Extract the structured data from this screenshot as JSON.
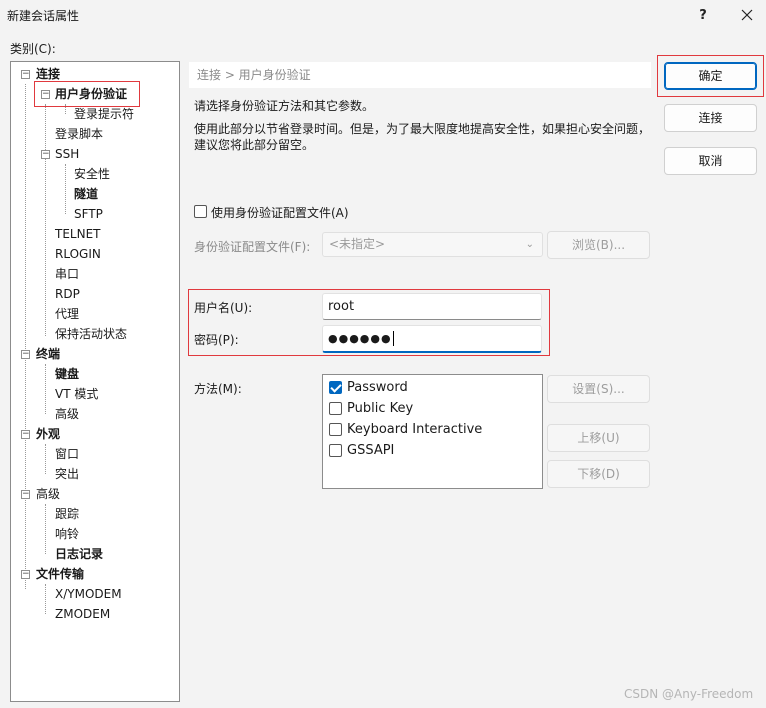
{
  "window": {
    "title": "新建会话属性",
    "help": "?",
    "close": "✕"
  },
  "category_label": "类别(C):",
  "tree": {
    "items": [
      {
        "label": "连接",
        "bold": true
      },
      {
        "label": "用户身份验证",
        "bold": true
      },
      {
        "label": "登录提示符",
        "bold": false
      },
      {
        "label": "登录脚本",
        "bold": false
      },
      {
        "label": "SSH",
        "bold": false
      },
      {
        "label": "安全性",
        "bold": false
      },
      {
        "label": "隧道",
        "bold": true
      },
      {
        "label": "SFTP",
        "bold": false
      },
      {
        "label": "TELNET",
        "bold": false
      },
      {
        "label": "RLOGIN",
        "bold": false
      },
      {
        "label": "串口",
        "bold": false
      },
      {
        "label": "RDP",
        "bold": false
      },
      {
        "label": "代理",
        "bold": false
      },
      {
        "label": "保持活动状态",
        "bold": false
      },
      {
        "label": "终端",
        "bold": true
      },
      {
        "label": "键盘",
        "bold": true
      },
      {
        "label": "VT 模式",
        "bold": false
      },
      {
        "label": "高级",
        "bold": false
      },
      {
        "label": "外观",
        "bold": true
      },
      {
        "label": "窗口",
        "bold": false
      },
      {
        "label": "突出",
        "bold": false
      },
      {
        "label": "高级",
        "bold": false
      },
      {
        "label": "跟踪",
        "bold": false
      },
      {
        "label": "响铃",
        "bold": false
      },
      {
        "label": "日志记录",
        "bold": true
      },
      {
        "label": "文件传输",
        "bold": true
      },
      {
        "label": "X/YMODEM",
        "bold": false
      },
      {
        "label": "ZMODEM",
        "bold": false
      }
    ]
  },
  "breadcrumb": "连接 > 用户身份验证",
  "description": {
    "line1": "请选择身份验证方法和其它参数。",
    "line2": "使用此部分以节省登录时间。但是，为了最大限度地提高安全性，如果担心安全问题，建议您将此部分留空。"
  },
  "profile": {
    "checkbox_label": "使用身份验证配置文件(A)",
    "checked": false,
    "file_label": "身份验证配置文件(F):",
    "file_value": "<未指定>",
    "browse_button": "浏览(B)..."
  },
  "credentials": {
    "username_label": "用户名(U):",
    "username_value": "root",
    "password_label": "密码(P):",
    "password_value": "●●●●●●"
  },
  "method": {
    "label": "方法(M):",
    "items": [
      {
        "label": "Password",
        "checked": true
      },
      {
        "label": "Public Key",
        "checked": false
      },
      {
        "label": "Keyboard Interactive",
        "checked": false
      },
      {
        "label": "GSSAPI",
        "checked": false
      }
    ],
    "settings_button": "设置(S)...",
    "move_up_button": "上移(U)",
    "move_down_button": "下移(D)"
  },
  "buttons": {
    "ok": "确定",
    "connect": "连接",
    "cancel": "取消"
  },
  "watermark": "CSDN @Any-Freedom",
  "colors": {
    "accent": "#0067c0",
    "highlight_box": "#e0393e"
  }
}
